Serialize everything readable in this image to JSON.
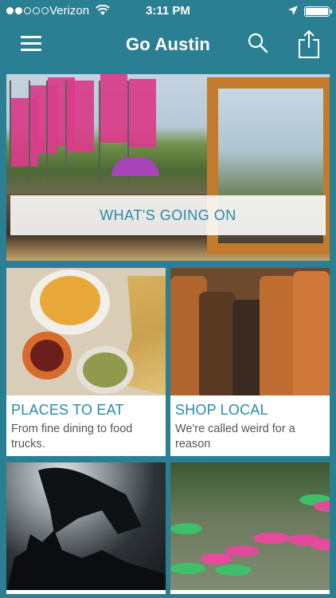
{
  "status_bar": {
    "carrier": "Verizon",
    "time": "3:11 PM",
    "signal_bars": 2,
    "signal_total": 5,
    "battery_level": 1.0
  },
  "navbar": {
    "title": "Go Austin"
  },
  "hero": {
    "label": "WHAT'S GOING ON"
  },
  "cards": [
    {
      "title": "PLACES TO EAT",
      "description": "From fine dining to food trucks."
    },
    {
      "title": "SHOP LOCAL",
      "description": "We're called weird for a reason"
    },
    {
      "title": "",
      "description": ""
    },
    {
      "title": "",
      "description": ""
    }
  ],
  "colors": {
    "header_bg": "#2a7f93",
    "accent_text": "#2a8aa5",
    "card_bg": "#ffffff"
  },
  "icons": {
    "menu": "hamburger-icon",
    "search": "search-icon",
    "share": "share-icon",
    "wifi": "wifi-icon",
    "location": "location-arrow-icon",
    "battery": "battery-icon"
  }
}
